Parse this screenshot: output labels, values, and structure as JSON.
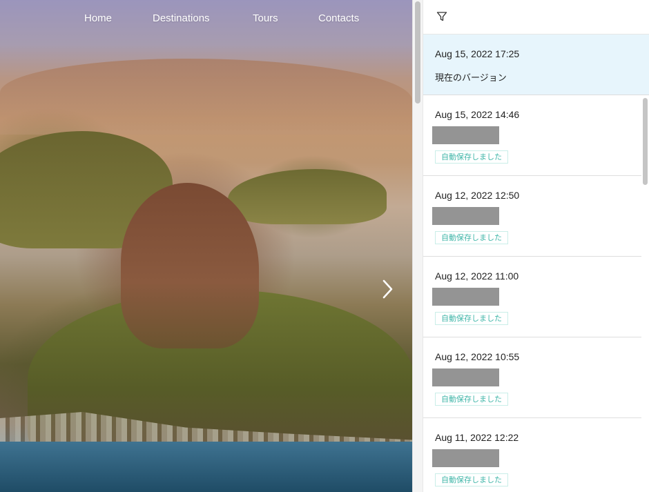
{
  "nav": {
    "items": [
      "Home",
      "Destinations",
      "Tours",
      "Contacts"
    ]
  },
  "carousel": {
    "next_icon": "chevron-right-icon"
  },
  "panel": {
    "filter_icon": "filter-icon",
    "current": {
      "timestamp": "Aug 15, 2022 17:25",
      "label": "現在のバージョン"
    },
    "versions": [
      {
        "timestamp": "Aug 15, 2022 14:46",
        "badge": "自動保存しました"
      },
      {
        "timestamp": "Aug 12, 2022 12:50",
        "badge": "自動保存しました"
      },
      {
        "timestamp": "Aug 12, 2022 11:00",
        "badge": "自動保存しました"
      },
      {
        "timestamp": "Aug 12, 2022 10:55",
        "badge": "自動保存しました"
      },
      {
        "timestamp": "Aug 11, 2022 12:22",
        "badge": "自動保存しました"
      }
    ]
  },
  "colors": {
    "selected_bg": "#e7f5fc",
    "badge_text": "#3fb6a8",
    "badge_border": "#c9eee8",
    "redaction": "#949494"
  }
}
